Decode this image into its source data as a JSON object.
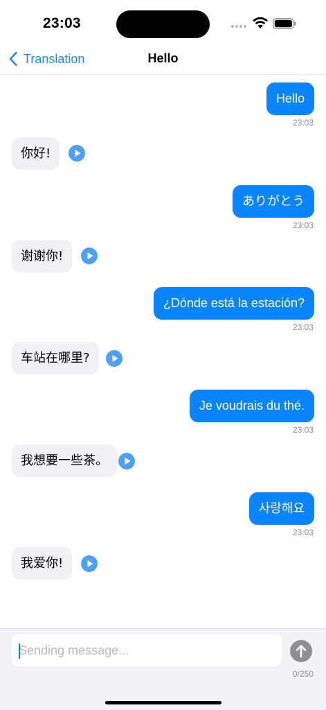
{
  "status_bar": {
    "time": "23:03",
    "icons": [
      "signal-dots-icon",
      "wifi-icon",
      "battery-icon"
    ]
  },
  "nav": {
    "back_label": "Translation",
    "title": "Hello",
    "back_icon": "chevron-left-icon"
  },
  "colors": {
    "accent": "#0a84ff",
    "incoming_bubble": "#f0f0f5",
    "play_button": "#4da1f5",
    "send_button": "#8e8e93"
  },
  "messages": [
    {
      "outgoing": "Hello",
      "time": "23:03",
      "translation": "你好!"
    },
    {
      "outgoing": "ありがとう",
      "time": "23:03",
      "translation": "谢谢你!"
    },
    {
      "outgoing": "¿Dónde está la estación?",
      "time": "23:03",
      "translation": "车站在哪里?"
    },
    {
      "outgoing": "Je voudrais du thé.",
      "time": "23:03",
      "translation": "我想要一些茶。"
    },
    {
      "outgoing": "사랑해요",
      "time": "23:03",
      "translation": "我爱你!"
    }
  ],
  "composer": {
    "placeholder": "Sending message...",
    "value": "",
    "char_count": "0/250",
    "send_icon": "arrow-up-icon"
  }
}
